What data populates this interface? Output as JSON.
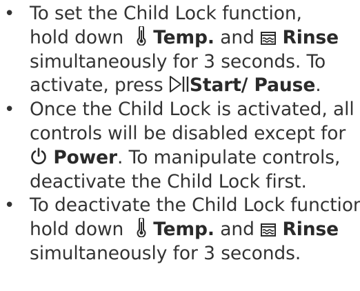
{
  "instructions": [
    {
      "intro": "To set the Child Lock function,",
      "hold_down": "hold down",
      "temp_label": "Temp.",
      "and": "and",
      "rinse_label": "Rinse",
      "simultaneously": "simultaneously for 3 seconds. To",
      "activate_press": "activate, press",
      "start_pause_label": "Start/ Pause",
      "period": "."
    },
    {
      "line1": "Once the Child Lock is activated, all",
      "line2": "controls will be disabled except for",
      "power_label": "Power",
      "line3_rest": ". To manipulate controls,",
      "line4": "deactivate the Child Lock first."
    },
    {
      "intro": "To deactivate the Child Lock function,",
      "hold_down": "hold down",
      "temp_label": "Temp.",
      "and": "and",
      "rinse_label": "Rinse",
      "simultaneously": "simultaneously for 3 seconds."
    }
  ],
  "bullet": "•",
  "icons": {
    "temp": "thermometer-icon",
    "rinse": "rinse-icon",
    "start_pause": "start-pause-icon",
    "power": "power-icon"
  }
}
